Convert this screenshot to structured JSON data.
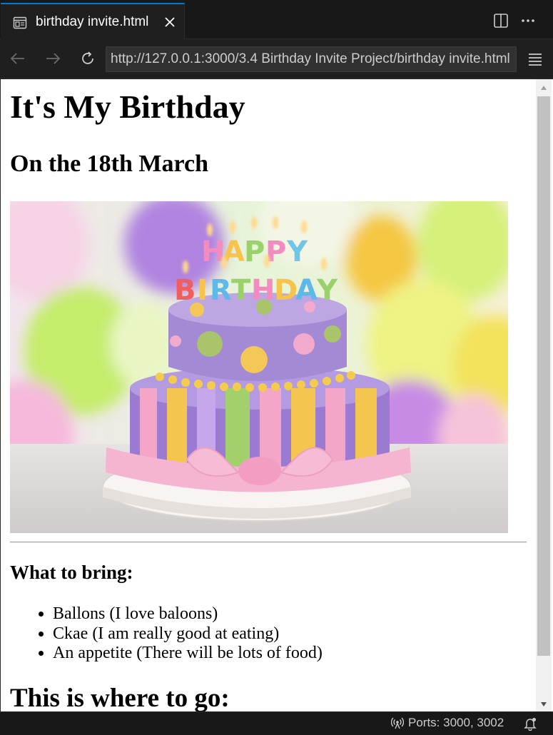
{
  "tab": {
    "title": "birthday invite.html",
    "icon": "preview-icon"
  },
  "nav": {
    "url": "http://127.0.0.1:3000/3.4 Birthday Invite Project/birthday invite.html"
  },
  "page": {
    "heading": "It's My Birthday",
    "date_heading": "On the 18th March",
    "image": "birthday-cake-image",
    "bring_heading": "What to bring:",
    "bring_items": [
      "Ballons (I love baloons)",
      "Ckae (I am really good at eating)",
      "An appetite (There will be lots of food)"
    ],
    "where_heading": "This is where to go:"
  },
  "status": {
    "ports": "Ports: 3000, 3002"
  },
  "colors": {
    "accent": "#0078d4",
    "editor_bg": "#1f1f1f",
    "tabbar_bg": "#181818"
  }
}
